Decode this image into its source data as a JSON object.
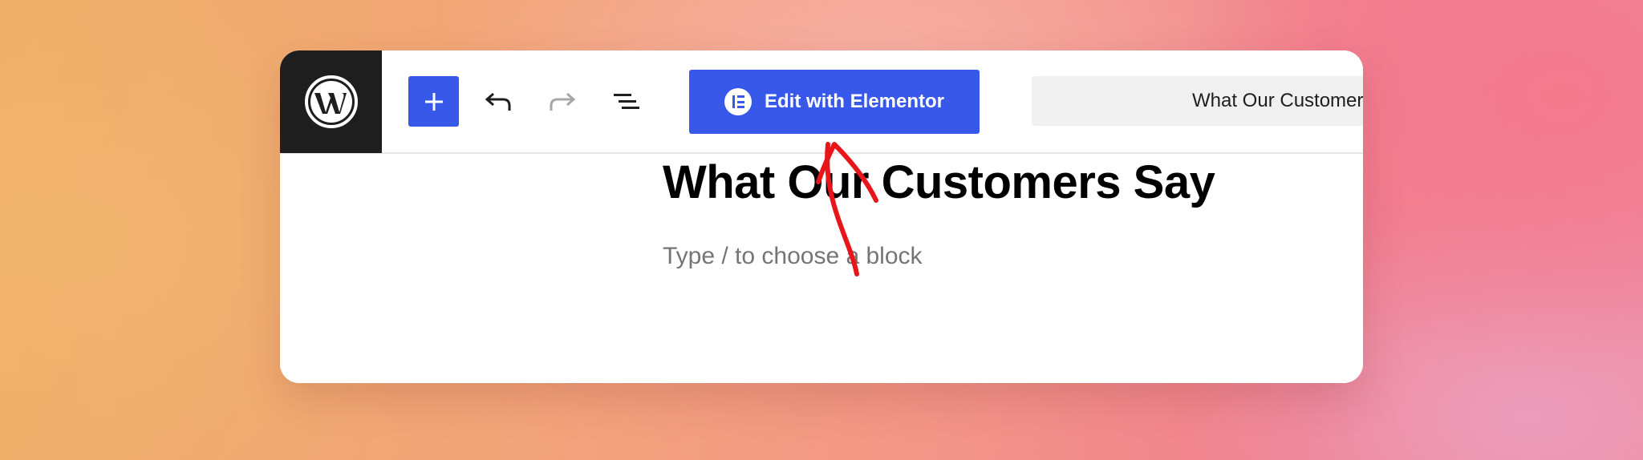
{
  "toolbar": {
    "logo_icon": "wordpress-icon",
    "inserter_icon": "plus-icon",
    "undo_icon": "undo-icon",
    "redo_icon": "redo-icon",
    "outline_icon": "list-view-icon",
    "elementor_button_label": "Edit with Elementor",
    "elementor_icon": "elementor-icon",
    "document_title": "What Our Customers Say"
  },
  "editor": {
    "post_title": "What Our Customers Say",
    "block_placeholder": "Type / to choose a block"
  },
  "annotation": {
    "arrow_icon": "red-arrow-annotation",
    "arrow_color": "#e8151b"
  },
  "colors": {
    "accent": "#3858e9",
    "logo_bg": "#1e1e1e"
  }
}
